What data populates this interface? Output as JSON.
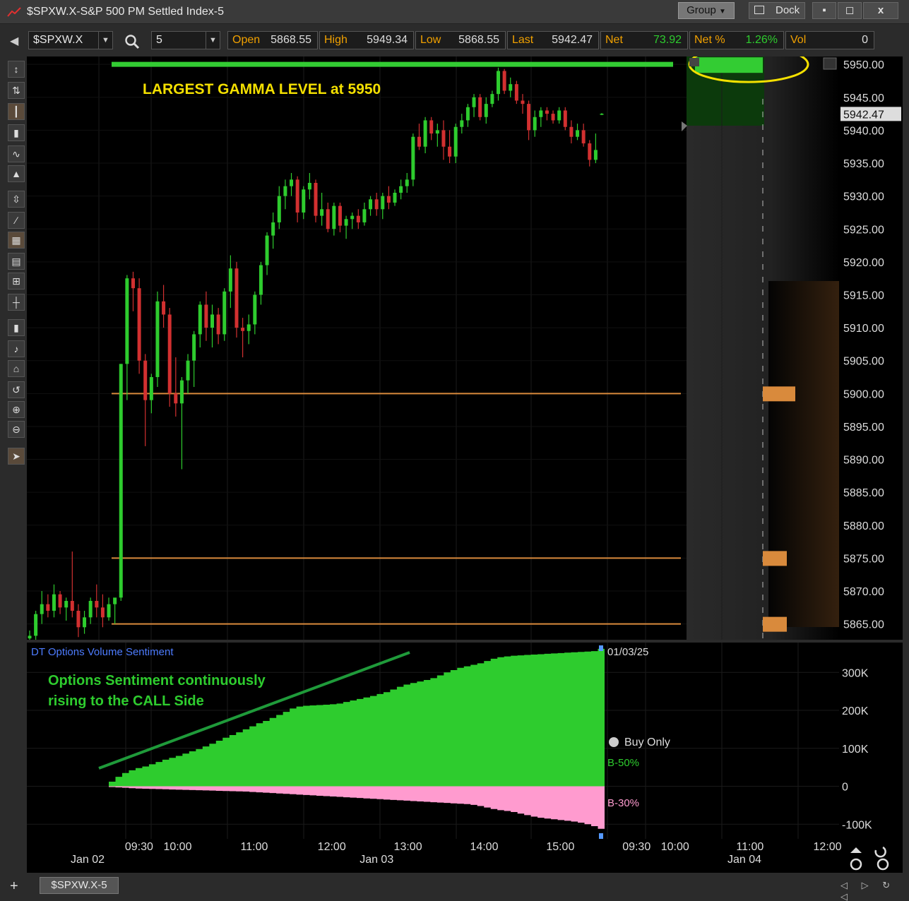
{
  "window": {
    "title": "$SPXW.X-S&P 500 PM Settled Index-5",
    "group_label": "Group",
    "dock_label": "Dock",
    "min_glyph": "▪",
    "max_glyph": "◻",
    "close_glyph": "x"
  },
  "toolbar": {
    "symbol": "$SPXW.X",
    "interval": "5",
    "quotes": [
      {
        "label": "Open",
        "value": "5868.55"
      },
      {
        "label": "High",
        "value": "5949.34"
      },
      {
        "label": "Low",
        "value": "5868.55"
      },
      {
        "label": "Last",
        "value": "5942.47"
      },
      {
        "label": "Net",
        "value": "73.92"
      },
      {
        "label": "Net %",
        "value": "1.26%"
      },
      {
        "label": "Vol",
        "value": "0"
      }
    ],
    "colors": {
      "label": "#f0a000",
      "positive": "#2ecc2e"
    }
  },
  "tab": {
    "label": "$SPXW.X-5"
  },
  "annotations": {
    "gamma_text": "LARGEST GAMMA LEVEL at 5950",
    "sentiment_text_1": "Options Sentiment continuously",
    "sentiment_text_2": "rising to the CALL Side"
  },
  "chart_data": [
    {
      "type": "candlestick",
      "price_axis": {
        "min": 5862.6,
        "max": 5951.2,
        "ticks": [
          5865,
          5870,
          5875,
          5880,
          5885,
          5890,
          5895,
          5900,
          5905,
          5910,
          5915,
          5920,
          5925,
          5930,
          5935,
          5940,
          5945,
          5950
        ],
        "last_label": "5942.47"
      },
      "levels": [
        {
          "price": 5950,
          "color": "#33cc33",
          "kind": "gamma"
        },
        {
          "price": 5900,
          "color": "#d98a3c",
          "kind": "level"
        },
        {
          "price": 5875,
          "color": "#d98a3c",
          "kind": "level"
        },
        {
          "price": 5865,
          "color": "#d98a3c",
          "kind": "level"
        }
      ],
      "colors": {
        "up": "#2ecc2e",
        "down": "#d23030",
        "bg": "#000000"
      },
      "candles": [
        [
          5862.8,
          5864.0,
          5862.6,
          5863.2
        ],
        [
          5863.2,
          5867.0,
          5862.6,
          5866.5
        ],
        [
          5866.5,
          5870.0,
          5865.0,
          5868.0
        ],
        [
          5868.0,
          5869.5,
          5866.0,
          5867.0
        ],
        [
          5867.0,
          5871.0,
          5866.0,
          5869.5
        ],
        [
          5869.5,
          5870.0,
          5866.5,
          5867.5
        ],
        [
          5867.5,
          5869.0,
          5865.5,
          5868.5
        ],
        [
          5868.5,
          5876.0,
          5866.0,
          5867.0
        ],
        [
          5867.0,
          5868.0,
          5863.0,
          5864.5
        ],
        [
          5864.5,
          5867.0,
          5863.5,
          5866.0
        ],
        [
          5866.0,
          5869.0,
          5865.0,
          5868.5
        ],
        [
          5868.5,
          5871.0,
          5866.0,
          5867.5
        ],
        [
          5867.5,
          5869.5,
          5864.5,
          5866.0
        ],
        [
          5866.0,
          5869.0,
          5865.5,
          5868.0
        ],
        [
          5868.0,
          5868.5,
          5865.0,
          5869.0
        ],
        [
          5869.0,
          5904.5,
          5868.5,
          5904.5
        ],
        [
          5904.5,
          5918.0,
          5899.0,
          5917.5
        ],
        [
          5917.5,
          5918.5,
          5912.5,
          5916.0
        ],
        [
          5916.0,
          5917.5,
          5903.0,
          5905.0
        ],
        [
          5905.0,
          5906.0,
          5892.0,
          5899.0
        ],
        [
          5899.0,
          5903.0,
          5897.0,
          5902.5
        ],
        [
          5902.5,
          5915.5,
          5901.0,
          5914.0
        ],
        [
          5914.0,
          5916.5,
          5910.0,
          5912.0
        ],
        [
          5912.0,
          5913.0,
          5898.0,
          5900.0
        ],
        [
          5900.0,
          5905.5,
          5896.5,
          5898.5
        ],
        [
          5898.5,
          5902.5,
          5888.5,
          5902.0
        ],
        [
          5902.0,
          5906.0,
          5900.0,
          5905.0
        ],
        [
          5905.0,
          5909.5,
          5901.0,
          5909.0
        ],
        [
          5909.0,
          5914.0,
          5907.0,
          5913.5
        ],
        [
          5913.5,
          5915.5,
          5908.0,
          5910.0
        ],
        [
          5910.0,
          5913.5,
          5907.0,
          5912.0
        ],
        [
          5912.0,
          5913.0,
          5907.5,
          5909.0
        ],
        [
          5909.0,
          5916.0,
          5908.0,
          5915.5
        ],
        [
          5915.5,
          5921.0,
          5913.0,
          5919.0
        ],
        [
          5919.0,
          5920.0,
          5908.5,
          5910.0
        ],
        [
          5910.0,
          5911.5,
          5905.5,
          5909.5
        ],
        [
          5909.5,
          5912.0,
          5907.5,
          5910.5
        ],
        [
          5910.5,
          5915.5,
          5909.0,
          5915.0
        ],
        [
          5915.0,
          5920.0,
          5913.5,
          5919.5
        ],
        [
          5919.5,
          5924.5,
          5918.0,
          5924.0
        ],
        [
          5924.0,
          5927.5,
          5922.0,
          5926.0
        ],
        [
          5926.0,
          5931.5,
          5925.0,
          5930.0
        ],
        [
          5930.0,
          5932.5,
          5928.0,
          5931.5
        ],
        [
          5931.5,
          5933.5,
          5930.0,
          5932.5
        ],
        [
          5932.5,
          5933.0,
          5926.0,
          5927.5
        ],
        [
          5927.5,
          5931.5,
          5926.5,
          5931.0
        ],
        [
          5931.0,
          5933.5,
          5929.5,
          5932.0
        ],
        [
          5932.0,
          5932.5,
          5926.0,
          5927.0
        ],
        [
          5927.0,
          5930.5,
          5925.5,
          5928.0
        ],
        [
          5928.0,
          5929.0,
          5924.5,
          5925.0
        ],
        [
          5925.0,
          5929.0,
          5924.0,
          5928.5
        ],
        [
          5928.5,
          5929.0,
          5924.5,
          5925.5
        ],
        [
          5925.5,
          5927.0,
          5923.5,
          5926.5
        ],
        [
          5926.5,
          5927.5,
          5925.0,
          5927.0
        ],
        [
          5927.0,
          5928.0,
          5925.0,
          5926.0
        ],
        [
          5926.0,
          5929.0,
          5925.5,
          5928.0
        ],
        [
          5928.0,
          5930.0,
          5927.0,
          5929.5
        ],
        [
          5929.5,
          5930.5,
          5927.0,
          5928.0
        ],
        [
          5928.0,
          5930.5,
          5926.5,
          5930.0
        ],
        [
          5930.0,
          5931.5,
          5928.0,
          5929.0
        ],
        [
          5929.0,
          5931.0,
          5928.5,
          5930.5
        ],
        [
          5930.5,
          5932.5,
          5929.5,
          5931.5
        ],
        [
          5931.5,
          5933.5,
          5930.5,
          5932.5
        ],
        [
          5932.5,
          5939.5,
          5931.5,
          5939.0
        ],
        [
          5939.0,
          5941.0,
          5937.0,
          5937.5
        ],
        [
          5937.5,
          5942.0,
          5936.5,
          5941.5
        ],
        [
          5941.5,
          5942.0,
          5938.5,
          5939.5
        ],
        [
          5939.5,
          5941.0,
          5937.5,
          5940.0
        ],
        [
          5940.0,
          5941.5,
          5935.5,
          5937.5
        ],
        [
          5937.5,
          5940.0,
          5935.0,
          5936.0
        ],
        [
          5936.0,
          5941.0,
          5935.0,
          5940.5
        ],
        [
          5940.5,
          5942.5,
          5939.5,
          5941.5
        ],
        [
          5941.5,
          5944.0,
          5940.5,
          5943.5
        ],
        [
          5943.5,
          5945.5,
          5942.0,
          5945.0
        ],
        [
          5945.0,
          5945.5,
          5941.5,
          5942.0
        ],
        [
          5942.0,
          5945.0,
          5941.0,
          5944.0
        ],
        [
          5944.0,
          5946.0,
          5943.5,
          5945.5
        ],
        [
          5945.5,
          5949.5,
          5944.5,
          5949.0
        ],
        [
          5949.0,
          5949.3,
          5945.5,
          5946.0
        ],
        [
          5946.0,
          5948.0,
          5945.0,
          5947.0
        ],
        [
          5947.0,
          5947.5,
          5944.0,
          5944.5
        ],
        [
          5944.5,
          5945.5,
          5942.5,
          5944.0
        ],
        [
          5944.0,
          5944.5,
          5938.5,
          5940.0
        ],
        [
          5940.0,
          5943.0,
          5939.0,
          5942.0
        ],
        [
          5942.0,
          5943.5,
          5940.5,
          5943.0
        ],
        [
          5943.0,
          5943.5,
          5941.5,
          5942.5
        ],
        [
          5942.5,
          5943.0,
          5941.0,
          5941.5
        ],
        [
          5941.5,
          5943.5,
          5941.0,
          5943.0
        ],
        [
          5943.0,
          5943.5,
          5940.0,
          5940.5
        ],
        [
          5940.5,
          5941.5,
          5938.0,
          5939.0
        ],
        [
          5939.0,
          5941.0,
          5938.5,
          5940.0
        ],
        [
          5940.0,
          5941.0,
          5937.5,
          5938.0
        ],
        [
          5938.0,
          5938.5,
          5934.5,
          5935.5
        ],
        [
          5935.5,
          5939.5,
          5935.0,
          5937.0
        ],
        [
          5942.4,
          5942.6,
          5942.3,
          5942.5
        ]
      ]
    },
    {
      "type": "area",
      "title": "DT Options Volume Sentiment",
      "date_label": "01/03/25",
      "legend_title": "Buy Only",
      "series": [
        {
          "name": "B-50%",
          "color": "#2ecc2e",
          "values": [
            12000,
            25000,
            35000,
            42000,
            48000,
            52000,
            58000,
            64000,
            70000,
            75000,
            80000,
            86000,
            92000,
            98000,
            105000,
            112000,
            120000,
            128000,
            135000,
            142000,
            150000,
            158000,
            166000,
            172000,
            180000,
            188000,
            196000,
            205000,
            210000,
            212000,
            213000,
            214000,
            215000,
            216000,
            218000,
            222000,
            226000,
            230000,
            234000,
            238000,
            243000,
            248000,
            255000,
            262000,
            268000,
            272000,
            276000,
            280000,
            285000,
            292000,
            300000,
            306000,
            312000,
            316000,
            320000,
            324000,
            330000,
            336000,
            340000,
            342000,
            344000,
            345000,
            346000,
            347000,
            348000,
            349000,
            350000,
            351000,
            352000,
            353000,
            354000,
            355000,
            356000,
            362000
          ]
        },
        {
          "name": "B-30%",
          "color": "#ff9bcf",
          "values": [
            -2000,
            -3000,
            -4000,
            -5000,
            -6000,
            -6500,
            -7000,
            -7500,
            -8000,
            -8500,
            -9000,
            -9500,
            -10000,
            -10500,
            -11000,
            -11500,
            -12000,
            -12500,
            -13000,
            -13500,
            -14000,
            -15000,
            -16000,
            -17000,
            -18000,
            -19000,
            -20000,
            -21000,
            -22000,
            -23000,
            -24000,
            -25000,
            -26000,
            -27000,
            -28000,
            -29000,
            -30000,
            -31000,
            -32000,
            -33000,
            -34000,
            -35000,
            -36000,
            -37000,
            -38000,
            -39000,
            -40000,
            -41000,
            -42000,
            -43000,
            -44000,
            -45000,
            -46000,
            -47000,
            -49000,
            -52000,
            -56000,
            -60000,
            -63000,
            -65000,
            -68000,
            -72000,
            -76000,
            -80000,
            -83000,
            -85000,
            -87000,
            -89000,
            -91000,
            -93000,
            -96000,
            -100000,
            -105000,
            -112000
          ]
        }
      ],
      "y_axis": {
        "min": -120000,
        "max": 360000,
        "ticks": [
          -100000,
          0,
          100000,
          200000,
          300000
        ],
        "tick_labels": [
          "-100K",
          "0",
          "100K",
          "200K",
          "300K"
        ]
      }
    }
  ],
  "time_axis": {
    "ticks": [
      {
        "label": "09:30",
        "x": 0.112
      },
      {
        "label": "10:00",
        "x": 0.156
      },
      {
        "label": "11:00",
        "x": 0.244
      },
      {
        "label": "12:00",
        "x": 0.332
      },
      {
        "label": "13:00",
        "x": 0.419
      },
      {
        "label": "14:00",
        "x": 0.506
      },
      {
        "label": "15:00",
        "x": 0.593
      },
      {
        "label": "09:30",
        "x": 0.68
      },
      {
        "label": "10:00",
        "x": 0.724
      },
      {
        "label": "11:00",
        "x": 0.81
      },
      {
        "label": "12:00",
        "x": 0.898
      }
    ],
    "dates": [
      {
        "label": "Jan 02",
        "x": 0.05
      },
      {
        "label": "Jan 03",
        "x": 0.38
      },
      {
        "label": "Jan 04",
        "x": 0.8
      }
    ]
  }
}
